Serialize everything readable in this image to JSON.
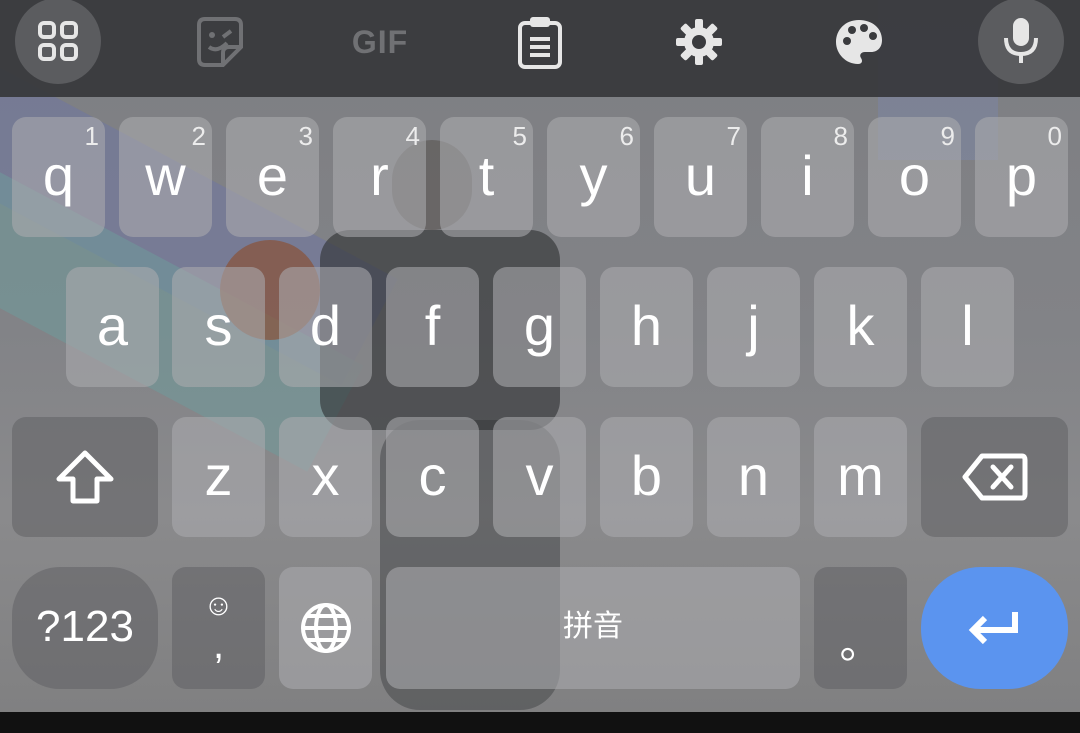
{
  "toolbar": {
    "items": [
      {
        "name": "apps-grid-icon"
      },
      {
        "name": "sticker-icon"
      },
      {
        "name": "gif-icon",
        "label": "GIF"
      },
      {
        "name": "clipboard-icon"
      },
      {
        "name": "settings-gear-icon"
      },
      {
        "name": "theme-palette-icon"
      },
      {
        "name": "microphone-icon"
      }
    ]
  },
  "keyboard": {
    "row1": [
      {
        "label": "q",
        "hint": "1"
      },
      {
        "label": "w",
        "hint": "2"
      },
      {
        "label": "e",
        "hint": "3"
      },
      {
        "label": "r",
        "hint": "4"
      },
      {
        "label": "t",
        "hint": "5"
      },
      {
        "label": "y",
        "hint": "6"
      },
      {
        "label": "u",
        "hint": "7"
      },
      {
        "label": "i",
        "hint": "8"
      },
      {
        "label": "o",
        "hint": "9"
      },
      {
        "label": "p",
        "hint": "0"
      }
    ],
    "row2": [
      "a",
      "s",
      "d",
      "f",
      "g",
      "h",
      "j",
      "k",
      "l"
    ],
    "row3": [
      "z",
      "x",
      "c",
      "v",
      "b",
      "n",
      "m"
    ],
    "bottom": {
      "symbols": "?123",
      "comma": ",",
      "emoji_glyph": "☺",
      "space": "拼音",
      "period": "。"
    }
  },
  "colors": {
    "enter_key": "#5b94ef",
    "key_light": "#aaabae",
    "key_dark": "#606164"
  }
}
